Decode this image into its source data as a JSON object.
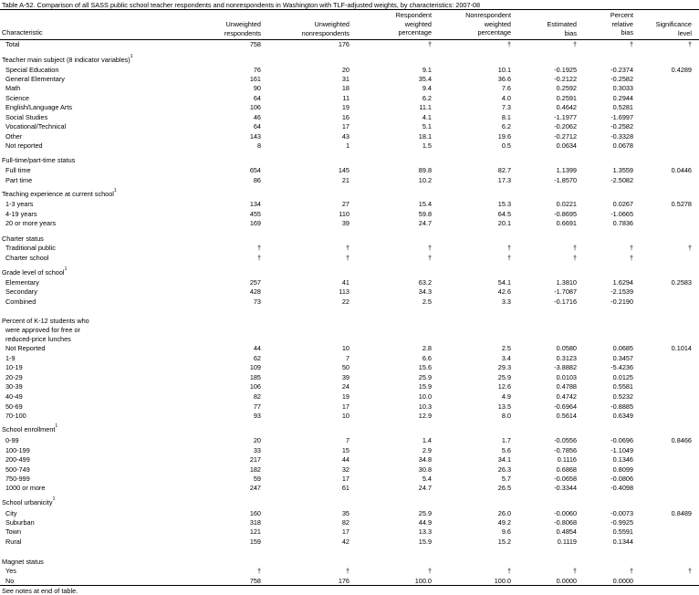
{
  "title": "Table A-52. Comparison of all SASS public school teacher respondents and nonrespondents in Washington with TLF-adjusted weights, by characteristics: 2007-08",
  "headers": {
    "characteristic": "Characteristic",
    "unw_resp": [
      "Unweighted",
      "respondents"
    ],
    "unw_nonresp": [
      "Unweighted",
      "nonrespondents"
    ],
    "resp_pct": [
      "Respondent",
      "weighted",
      "percentage"
    ],
    "nonresp_pct": [
      "Nonrespondent",
      "weighted",
      "percentage"
    ],
    "est_bias": [
      "Estimated",
      "bias"
    ],
    "pct_rel_bias": [
      "Percent",
      "relative",
      "bias"
    ],
    "sig": [
      "Significance",
      "level"
    ]
  },
  "rows": [
    {
      "label": "Total",
      "indent": true,
      "vals": [
        "758",
        "176",
        "†",
        "†",
        "†",
        "†",
        "†"
      ]
    },
    {
      "label": "Teacher main subject (8 indicator variables)",
      "sup": "1",
      "section": true,
      "vals": [
        "",
        "",
        "",
        "",
        "",
        "",
        ""
      ]
    },
    {
      "label": "Special Education",
      "indent": true,
      "vals": [
        "76",
        "20",
        "9.1",
        "10.1",
        "-0.1925",
        "-0.2374",
        "0.4289"
      ]
    },
    {
      "label": "General Elementary",
      "indent": true,
      "vals": [
        "161",
        "31",
        "35.4",
        "36.6",
        "-0.2122",
        "-0.2582",
        ""
      ]
    },
    {
      "label": "Math",
      "indent": true,
      "vals": [
        "90",
        "18",
        "9.4",
        "7.6",
        "0.2592",
        "0.3033",
        ""
      ]
    },
    {
      "label": "Science",
      "indent": true,
      "vals": [
        "64",
        "11",
        "6.2",
        "4.0",
        "0.2591",
        "0.2944",
        ""
      ]
    },
    {
      "label": "English/Language Arts",
      "indent": true,
      "vals": [
        "106",
        "19",
        "11.1",
        "7.3",
        "0.4642",
        "0.5281",
        ""
      ]
    },
    {
      "label": "Social Studies",
      "indent": true,
      "vals": [
        "46",
        "16",
        "4.1",
        "8.1",
        "-1.1977",
        "-1.6997",
        ""
      ]
    },
    {
      "label": "Vocational/Technical",
      "indent": true,
      "vals": [
        "64",
        "17",
        "5.1",
        "6.2",
        "-0.2062",
        "-0.2582",
        ""
      ]
    },
    {
      "label": "Other",
      "indent": true,
      "vals": [
        "143",
        "43",
        "18.1",
        "19.6",
        "-0.2712",
        "-0.3328",
        ""
      ]
    },
    {
      "label": "Not reported",
      "indent": true,
      "vals": [
        "8",
        "1",
        "1.5",
        "0.5",
        "0.0634",
        "0.0678",
        ""
      ]
    },
    {
      "label": "Full-time/part-time status",
      "section": true,
      "vals": [
        "",
        "",
        "",
        "",
        "",
        "",
        ""
      ]
    },
    {
      "label": "Full time",
      "indent": true,
      "vals": [
        "654",
        "145",
        "89.8",
        "82.7",
        "1.1399",
        "1.3559",
        "0.0446"
      ]
    },
    {
      "label": "Part time",
      "indent": true,
      "vals": [
        "86",
        "21",
        "10.2",
        "17.3",
        "-1.8570",
        "-2.5082",
        ""
      ]
    },
    {
      "label": "Teaching experience at current school",
      "sup": "1",
      "section": true,
      "vals": [
        "",
        "",
        "",
        "",
        "",
        "",
        ""
      ]
    },
    {
      "label": "1-3 years",
      "indent": true,
      "vals": [
        "134",
        "27",
        "15.4",
        "15.3",
        "0.0221",
        "0.0267",
        "0.5278"
      ]
    },
    {
      "label": "4-19 years",
      "indent": true,
      "vals": [
        "455",
        "110",
        "59.8",
        "64.5",
        "-0.8695",
        "-1.0665",
        ""
      ]
    },
    {
      "label": "20 or more years",
      "indent": true,
      "vals": [
        "169",
        "39",
        "24.7",
        "20.1",
        "0.6691",
        "0.7836",
        ""
      ]
    },
    {
      "label": "Charter status",
      "section": true,
      "vals": [
        "",
        "",
        "",
        "",
        "",
        "",
        ""
      ]
    },
    {
      "label": "Traditional public",
      "indent": true,
      "vals": [
        "†",
        "†",
        "†",
        "†",
        "†",
        "†",
        "†"
      ]
    },
    {
      "label": "Charter school",
      "indent": true,
      "vals": [
        "†",
        "†",
        "†",
        "†",
        "†",
        "†",
        ""
      ]
    },
    {
      "label": "Grade level of school",
      "sup": "1",
      "section": true,
      "vals": [
        "",
        "",
        "",
        "",
        "",
        "",
        ""
      ]
    },
    {
      "label": "Elementary",
      "indent": true,
      "vals": [
        "257",
        "41",
        "63.2",
        "54.1",
        "1.3810",
        "1.6294",
        "0.2583"
      ]
    },
    {
      "label": "Secondary",
      "indent": true,
      "vals": [
        "428",
        "113",
        "34.3",
        "42.6",
        "-1.7087",
        "-2.1539",
        ""
      ]
    },
    {
      "label": "Combined",
      "indent": true,
      "vals": [
        "73",
        "22",
        "2.5",
        "3.3",
        "-0.1716",
        "-0.2190",
        ""
      ]
    },
    {
      "label": "Percent of K-12 students who",
      "section": true,
      "vals": [
        "",
        "",
        "",
        "",
        "",
        "",
        ""
      ]
    },
    {
      "label": "were approved for free or",
      "indent": true,
      "vals": [
        "",
        "",
        "",
        "",
        "",
        "",
        ""
      ]
    },
    {
      "label": "reduced-price lunches",
      "indent": true,
      "vals": [
        "",
        "",
        "",
        "",
        "",
        "",
        ""
      ]
    },
    {
      "label": "Not Reported",
      "indent": true,
      "vals": [
        "44",
        "10",
        "2.8",
        "2.5",
        "0.0580",
        "0.0685",
        "0.1014"
      ]
    },
    {
      "label": "1-9",
      "indent": true,
      "vals": [
        "62",
        "7",
        "6.6",
        "3.4",
        "0.3123",
        "0.3457",
        ""
      ]
    },
    {
      "label": "10-19",
      "indent": true,
      "vals": [
        "109",
        "50",
        "15.6",
        "29.3",
        "-3.8882",
        "-5.4236",
        ""
      ]
    },
    {
      "label": "20-29",
      "indent": true,
      "vals": [
        "185",
        "39",
        "25.9",
        "25.9",
        "0.0103",
        "0.0125",
        ""
      ]
    },
    {
      "label": "30-39",
      "indent": true,
      "vals": [
        "106",
        "24",
        "15.9",
        "12.6",
        "0.4788",
        "0.5581",
        ""
      ]
    },
    {
      "label": "40-49",
      "indent": true,
      "vals": [
        "82",
        "19",
        "10.0",
        "4.9",
        "0.4742",
        "0.5232",
        ""
      ]
    },
    {
      "label": "50-69",
      "indent": true,
      "vals": [
        "77",
        "17",
        "10.3",
        "13.5",
        "-0.6964",
        "-0.8885",
        ""
      ]
    },
    {
      "label": "70-100",
      "indent": true,
      "vals": [
        "93",
        "10",
        "12.9",
        "8.0",
        "0.5614",
        "0.6349",
        ""
      ]
    },
    {
      "label": "School enrollment",
      "sup": "1",
      "section": true,
      "vals": [
        "",
        "",
        "",
        "",
        "",
        "",
        ""
      ]
    },
    {
      "label": "0-99",
      "indent": true,
      "vals": [
        "20",
        "7",
        "1.4",
        "1.7",
        "-0.0556",
        "-0.0696",
        "0.8466"
      ]
    },
    {
      "label": "100-199",
      "indent": true,
      "vals": [
        "33",
        "15",
        "2.9",
        "5.6",
        "-0.7856",
        "-1.1049",
        ""
      ]
    },
    {
      "label": "200-499",
      "indent": true,
      "vals": [
        "217",
        "44",
        "34.8",
        "34.1",
        "0.1116",
        "0.1346",
        ""
      ]
    },
    {
      "label": "500-749",
      "indent": true,
      "vals": [
        "182",
        "32",
        "30.8",
        "26.3",
        "0.6868",
        "0.8099",
        ""
      ]
    },
    {
      "label": "750-999",
      "indent": true,
      "vals": [
        "59",
        "17",
        "5.4",
        "5.7",
        "-0.0658",
        "-0.0806",
        ""
      ]
    },
    {
      "label": "1000 or more",
      "indent": true,
      "vals": [
        "247",
        "61",
        "24.7",
        "26.5",
        "-0.3344",
        "-0.4098",
        ""
      ]
    },
    {
      "label": "School urbanicity",
      "sup": "1",
      "section": true,
      "vals": [
        "",
        "",
        "",
        "",
        "",
        "",
        ""
      ]
    },
    {
      "label": "City",
      "indent": true,
      "vals": [
        "160",
        "35",
        "25.9",
        "26.0",
        "-0.0060",
        "-0.0073",
        "0.8489"
      ]
    },
    {
      "label": "Suburban",
      "indent": true,
      "vals": [
        "318",
        "82",
        "44.9",
        "49.2",
        "-0.8068",
        "-0.9925",
        ""
      ]
    },
    {
      "label": "Town",
      "indent": true,
      "vals": [
        "121",
        "17",
        "13.3",
        "9.6",
        "0.4854",
        "0.5591",
        ""
      ]
    },
    {
      "label": "Rural",
      "indent": true,
      "vals": [
        "159",
        "42",
        "15.9",
        "15.2",
        "0.1119",
        "0.1344",
        ""
      ]
    },
    {
      "label": "Magnet status",
      "section": true,
      "vals": [
        "",
        "",
        "",
        "",
        "",
        "",
        ""
      ]
    },
    {
      "label": "Yes",
      "indent": true,
      "vals": [
        "†",
        "†",
        "†",
        "†",
        "†",
        "†",
        "†"
      ]
    },
    {
      "label": "No",
      "indent": true,
      "vals": [
        "758",
        "176",
        "100.0",
        "100.0",
        "0.0000",
        "0.0000",
        ""
      ]
    }
  ],
  "note": "See notes at end of table."
}
